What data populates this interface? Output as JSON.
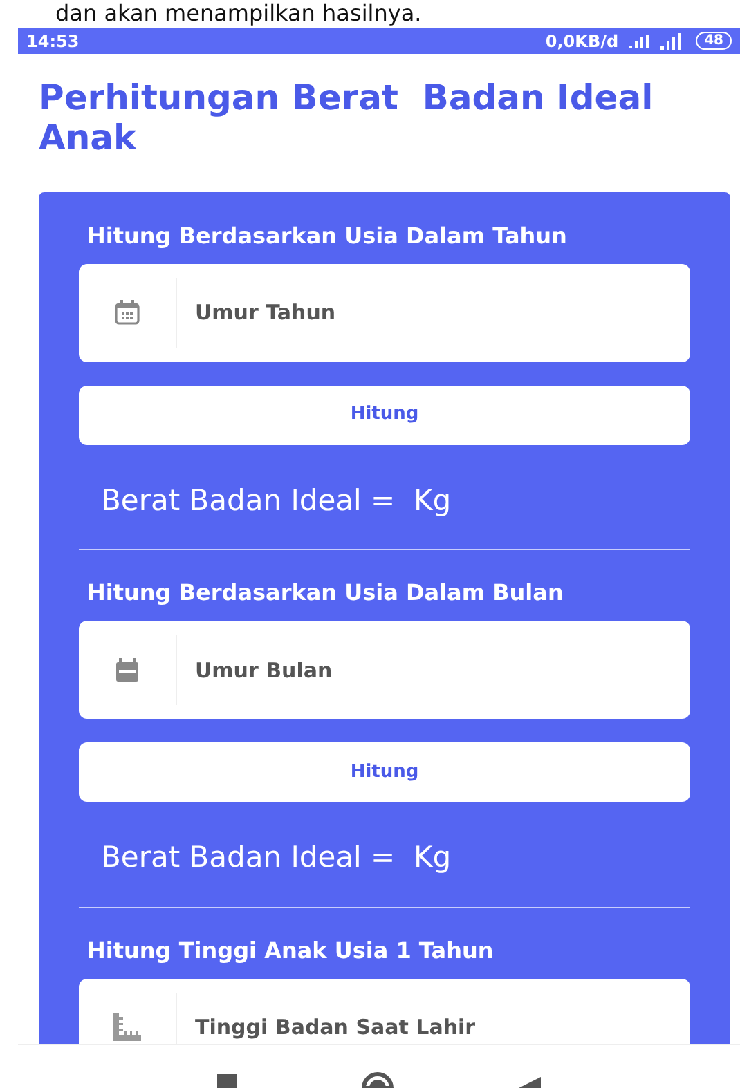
{
  "caption_fragment": "dan akan menampilkan hasilnya.",
  "status_bar": {
    "time": "14:53",
    "network_speed": "0,0KB/d",
    "battery": "48"
  },
  "title": "Perhitungan Berat  Badan Ideal Anak",
  "sections": [
    {
      "heading": "Hitung Berdasarkan Usia Dalam Tahun",
      "field": {
        "placeholder": "Umur Tahun",
        "kind": "calendar"
      },
      "button": "Hitung",
      "result": "Berat Badan Ideal =  Kg"
    },
    {
      "heading": "Hitung Berdasarkan Usia Dalam Bulan",
      "field": {
        "placeholder": "Umur Bulan",
        "kind": "event"
      },
      "button": "Hitung",
      "result": "Berat Badan Ideal =  Kg"
    },
    {
      "heading": "Hitung Tinggi Anak Usia 1 Tahun",
      "field": {
        "placeholder": "Tinggi Badan Saat Lahir",
        "kind": "ruler"
      }
    }
  ]
}
